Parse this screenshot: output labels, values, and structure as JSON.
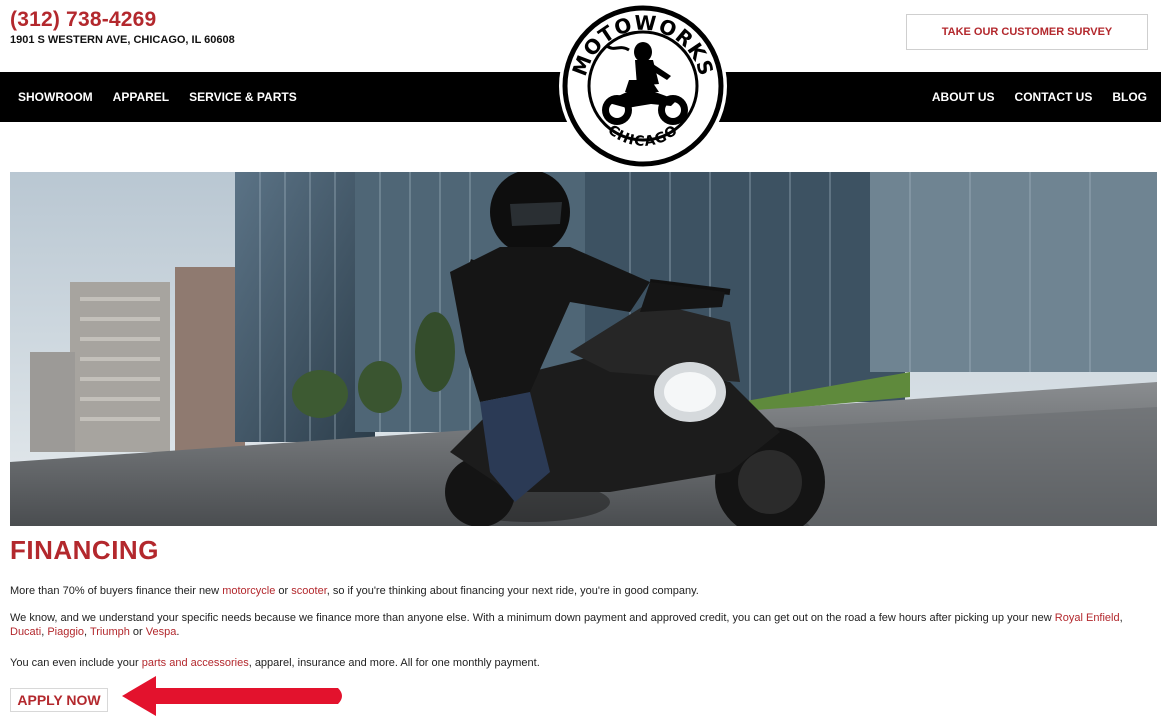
{
  "header": {
    "phone": "(312) 738-4269",
    "address": "1901 S WESTERN AVE, CHICAGO, IL 60608",
    "survey_label": "TAKE OUR CUSTOMER SURVEY"
  },
  "logo": {
    "top_text": "MOTOWORKS",
    "bottom_text": "CHICAGO"
  },
  "nav": {
    "left": [
      "SHOWROOM",
      "APPAREL",
      "SERVICE & PARTS"
    ],
    "right": [
      "ABOUT US",
      "CONTACT US",
      "BLOG"
    ]
  },
  "content": {
    "heading": "FINANCING",
    "p1": {
      "a": "More than 70% of buyers finance their new ",
      "link1": "motorcycle",
      "b": " or ",
      "link2": "scooter",
      "c": ", so if you're thinking about financing your next ride, you're in good company."
    },
    "p2": {
      "a": "We know, and we understand your specific needs because we finance more than anyone else. With a minimum down payment and approved credit, you can get out on the road a few hours after picking up your new ",
      "link1": "Royal Enfield",
      "sep1": ", ",
      "link2": "Ducati",
      "sep2": ", ",
      "link3": "Piaggio",
      "sep3": ", ",
      "link4": "Triumph",
      "sep4": " or ",
      "link5": "Vespa",
      "end": "."
    },
    "p3": {
      "a": "You can even include your ",
      "link1": "parts and accessories",
      "b": ", apparel, insurance and more. All for one monthly payment."
    },
    "apply_label": "APPLY NOW"
  },
  "colors": {
    "brand_red": "#b3282d",
    "nav_bg": "#000000",
    "arrow_red": "#e3122d"
  }
}
